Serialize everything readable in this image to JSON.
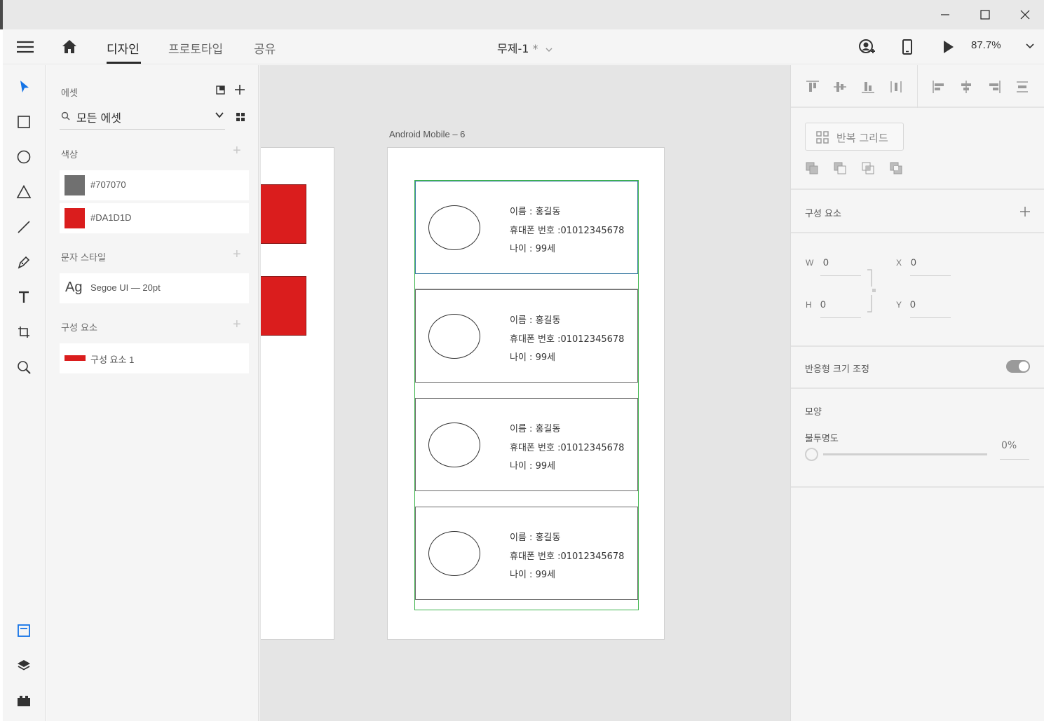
{
  "header": {
    "tabs": [
      {
        "label": "디자인",
        "active": true
      },
      {
        "label": "프로토타입",
        "active": false
      },
      {
        "label": "공유",
        "active": false
      }
    ],
    "doc_title": "무제-1",
    "doc_modified": "*",
    "zoom": "87.7%"
  },
  "toolbar": {
    "tools": [
      "select-icon",
      "rectangle-icon",
      "ellipse-icon",
      "triangle-icon",
      "line-icon",
      "pen-icon",
      "text-icon",
      "artboard-icon",
      "zoom-icon"
    ],
    "bottom": [
      "assets-icon",
      "layers-icon",
      "plugins-icon"
    ]
  },
  "assets": {
    "title": "에셋",
    "search_value": "모든 에셋",
    "colors_label": "색상",
    "colors": [
      {
        "hex": "#707070",
        "label": "#707070"
      },
      {
        "hex": "#DA1D1D",
        "label": "#DA1D1D"
      }
    ],
    "char_styles_label": "문자 스타일",
    "char_style": {
      "sample": "Ag",
      "label": "Segoe UI — 20pt"
    },
    "components_label": "구성 요소",
    "component": {
      "label": "구성 요소 1"
    }
  },
  "canvas": {
    "artboard_label": "Android Mobile – 6",
    "items": [
      {
        "name": "이름 : 홍길동",
        "phone": "휴대폰 번호 :01012345678",
        "age": "나이 : 99세"
      },
      {
        "name": "이름 : 홍길동",
        "phone": "휴대폰 번호 :01012345678",
        "age": "나이 : 99세"
      },
      {
        "name": "이름 : 홍길동",
        "phone": "휴대폰 번호 :01012345678",
        "age": "나이 : 99세"
      },
      {
        "name": "이름 : 홍길동",
        "phone": "휴대폰 번호 :01012345678",
        "age": "나이 : 99세"
      }
    ],
    "accent_red": "#DA1D1D",
    "selection_green": "#3CB44B"
  },
  "right_panel": {
    "repeat_grid_label": "반복 그리드",
    "component_label": "구성 요소",
    "w_key": "W",
    "w_val": "0",
    "h_key": "H",
    "h_val": "0",
    "x_key": "X",
    "x_val": "0",
    "y_key": "Y",
    "y_val": "0",
    "responsive_label": "반응형 크기 조정",
    "responsive_on": true,
    "appearance_label": "모양",
    "opacity_label": "불투명도",
    "opacity_value": "0%"
  }
}
